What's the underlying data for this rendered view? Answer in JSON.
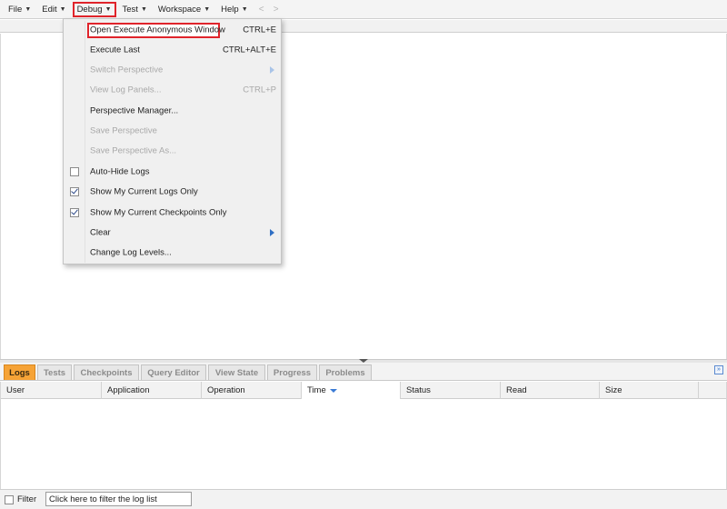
{
  "menubar": {
    "items": [
      {
        "label": "File"
      },
      {
        "label": "Edit"
      },
      {
        "label": "Debug"
      },
      {
        "label": "Test"
      },
      {
        "label": "Workspace"
      },
      {
        "label": "Help"
      }
    ],
    "active": "Debug",
    "nav_back": "<",
    "nav_forward": ">"
  },
  "debug_menu": {
    "items": [
      {
        "label": "Open Execute Anonymous Window",
        "shortcut": "CTRL+E",
        "enabled": true,
        "highlighted": true
      },
      {
        "label": "Execute Last",
        "shortcut": "CTRL+ALT+E",
        "enabled": true
      },
      {
        "label": "Switch Perspective",
        "shortcut": "",
        "enabled": false,
        "submenu": true
      },
      {
        "label": "View Log Panels...",
        "shortcut": "CTRL+P",
        "enabled": false
      },
      {
        "label": "Perspective Manager...",
        "shortcut": "",
        "enabled": true
      },
      {
        "label": "Save Perspective",
        "shortcut": "",
        "enabled": false
      },
      {
        "label": "Save Perspective As...",
        "shortcut": "",
        "enabled": false
      },
      {
        "label": "Auto-Hide Logs",
        "shortcut": "",
        "enabled": true,
        "checkbox": true,
        "checked": false
      },
      {
        "label": "Show My Current Logs Only",
        "shortcut": "",
        "enabled": true,
        "checkbox": true,
        "checked": true
      },
      {
        "label": "Show My Current Checkpoints Only",
        "shortcut": "",
        "enabled": true,
        "checkbox": true,
        "checked": true
      },
      {
        "label": "Clear",
        "shortcut": "",
        "enabled": true,
        "submenu": true
      },
      {
        "label": "Change Log Levels...",
        "shortcut": "",
        "enabled": true
      }
    ]
  },
  "bottom_tabs": {
    "items": [
      {
        "label": "Logs"
      },
      {
        "label": "Tests"
      },
      {
        "label": "Checkpoints"
      },
      {
        "label": "Query Editor"
      },
      {
        "label": "View State"
      },
      {
        "label": "Progress"
      },
      {
        "label": "Problems"
      }
    ],
    "active": "Logs",
    "collapse_icon": "double-chevron-down-icon"
  },
  "log_table": {
    "columns": [
      "User",
      "Application",
      "Operation",
      "Time",
      "Status",
      "Read",
      "Size"
    ],
    "sorted_column": "Time",
    "rows": []
  },
  "filter": {
    "label": "Filter",
    "value": "Click here to filter the log list",
    "checked": false
  },
  "colors": {
    "highlight_red": "#e0242b",
    "active_tab": "#f6a336",
    "accent_blue": "#2f6fc4"
  }
}
